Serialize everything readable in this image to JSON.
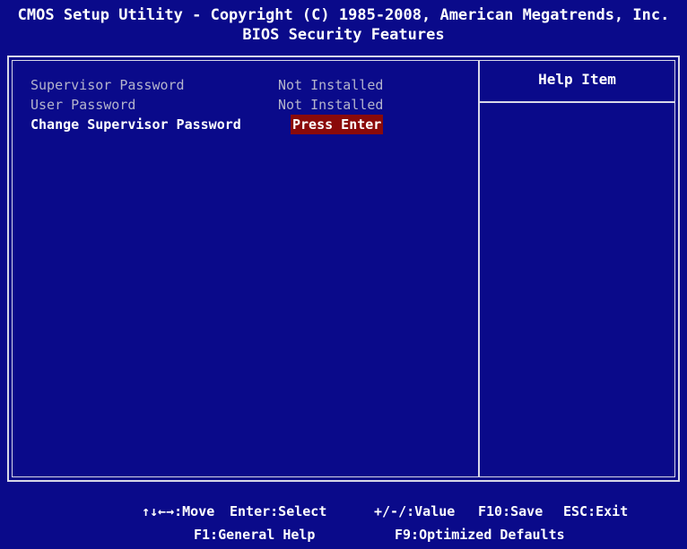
{
  "header": {
    "line1": "CMOS Setup Utility - Copyright (C) 1985-2008, American Megatrends, Inc.",
    "line2": "BIOS Security Features"
  },
  "items": [
    {
      "label": "Supervisor Password",
      "value": "Not Installed"
    },
    {
      "label": "User Password",
      "value": "Not Installed"
    },
    {
      "label": "Change Supervisor Password",
      "value": "Press Enter"
    }
  ],
  "help": {
    "title": "Help Item"
  },
  "footer": {
    "move": "↑↓←→:Move",
    "select": "Enter:Select",
    "value": "+/-/:Value",
    "save": "F10:Save",
    "exit": "ESC:Exit",
    "general_help": "F1:General Help",
    "defaults": "F9:Optimized Defaults"
  },
  "colors": {
    "background": "#0a0a8a",
    "highlight": "#8a0a0a",
    "disabled_text": "#b4b4cc"
  }
}
